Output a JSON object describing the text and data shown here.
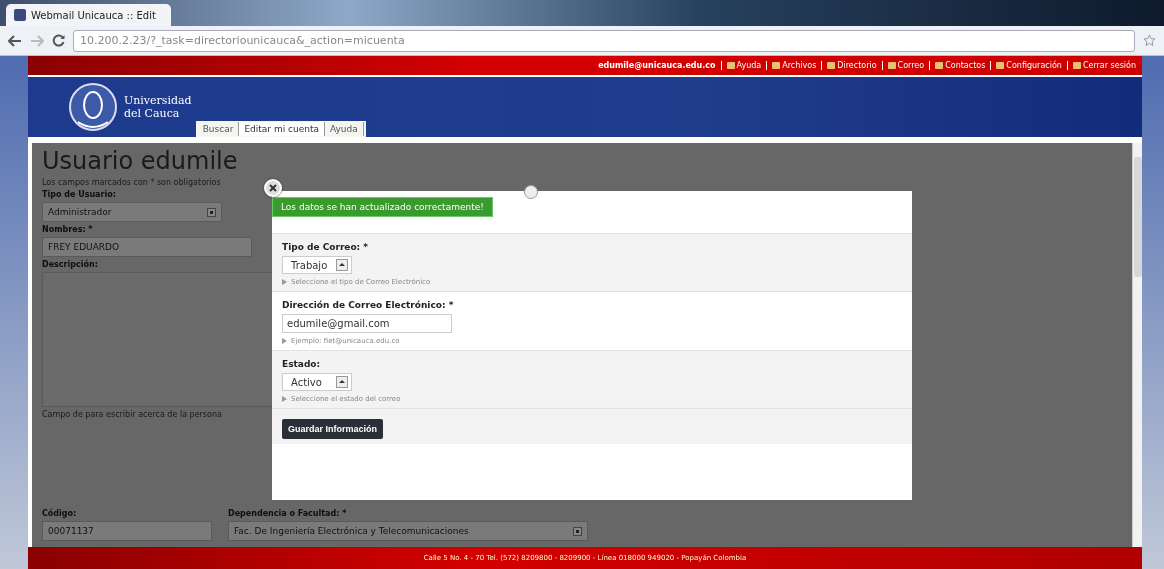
{
  "browser": {
    "tab_title": "Webmail Unicauca :: Edit",
    "url": "10.200.2.23/?_task=directoriounicauca&_action=micuenta"
  },
  "top_bar": {
    "user": "edumile@unicauca.edu.co",
    "links": [
      {
        "label": "Ayuda"
      },
      {
        "label": "Archivos"
      },
      {
        "label": "Directorio"
      },
      {
        "label": "Correo"
      },
      {
        "label": "Contactos"
      },
      {
        "label": "Configuración"
      },
      {
        "label": "Cerrar sesión"
      }
    ]
  },
  "header": {
    "logo_line_1": "Universidad",
    "logo_line_2": "del Cauca",
    "tabs": [
      {
        "label": "Buscar",
        "selected": false
      },
      {
        "label": "Editar mi cuenta",
        "selected": true
      },
      {
        "label": "Ayuda",
        "selected": false
      }
    ]
  },
  "page": {
    "title": "Usuario edumile",
    "note": "Los campos marcados con * son obligatorios",
    "user_type": {
      "label": "Tipo de Usuario:",
      "value": "Administrador"
    },
    "names": {
      "label": "Nombres: *",
      "value": "FREY EDUARDO"
    },
    "description": {
      "label": "Descripción:",
      "hint": "Campo de para escribir acerca de la persona"
    },
    "code": {
      "label": "Código:",
      "value": "00071137"
    },
    "faculty": {
      "label": "Dependencia o Facultad: *",
      "value": "Fac. De Ingeniería Electrónica y Telecomunicaciones"
    }
  },
  "modal": {
    "message": "Los datos se han actualizado correctamente!",
    "fields": [
      {
        "kind": "select",
        "label": "Tipo de Correo: *",
        "value": "Trabajo",
        "hint": "Seleccione el tipo de Correo Electrónico"
      },
      {
        "kind": "text",
        "label": "Dirección de Correo Electrónico: *",
        "value": "edumile@gmail.com",
        "hint": "Ejemplo: fiet@unicauca.edu.co"
      },
      {
        "kind": "select",
        "label": "Estado:",
        "value": "Activo",
        "hint": "Seleccione el estado del correo"
      }
    ],
    "button": "Guardar Información"
  },
  "footer": "Calle 5 No. 4 - 70 Tel. (572) 8209800 - 8209900 - Línea 018000 949020 - Popayán Colombia"
}
